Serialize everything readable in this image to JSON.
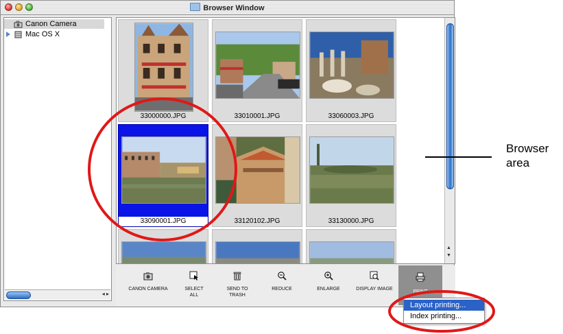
{
  "window": {
    "title": "Browser Window"
  },
  "sidebar": {
    "items": [
      {
        "label": "Canon Camera",
        "icon": "camera-icon",
        "selected": true
      },
      {
        "label": "Mac OS X",
        "icon": "disk-icon",
        "selected": false
      }
    ]
  },
  "browser": {
    "thumbnails": [
      {
        "name": "33000000.JPG"
      },
      {
        "name": "33010001.JPG"
      },
      {
        "name": "33060003.JPG"
      },
      {
        "name": "33090001.JPG",
        "selected": true
      },
      {
        "name": "33120102.JPG"
      },
      {
        "name": "33130000.JPG"
      }
    ]
  },
  "toolbar": {
    "canon_camera": "CANON CAMERA",
    "select_all_1": "SELECT",
    "select_all_2": "ALL",
    "send_trash_1": "SEND TO",
    "send_trash_2": "TRASH",
    "reduce": "REDUCE",
    "enlarge": "ENLARGE",
    "display_image": "DISPLAY IMAGE",
    "print": "PRINT"
  },
  "print_menu": {
    "items": [
      "Layout printing...",
      "Index printing..."
    ]
  },
  "callout": {
    "line1": "Browser",
    "line2": "area"
  },
  "colors": {
    "selection": "#0a14e6",
    "highlight_circle": "#e01818",
    "menu_highlight": "#2a62c8"
  }
}
